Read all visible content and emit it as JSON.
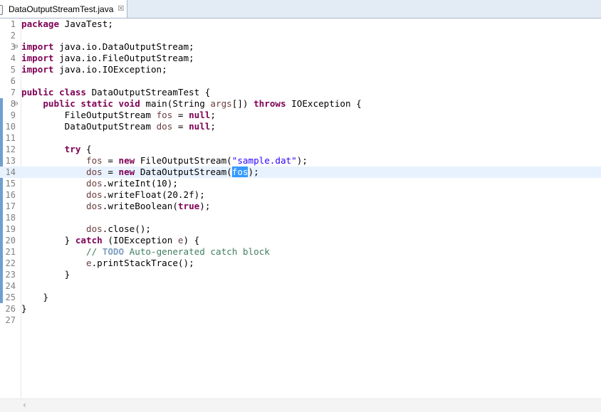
{
  "tab": {
    "title": "DataOutputStreamTest.java",
    "close_glyph": "☒"
  },
  "lines": [
    {
      "n": "1",
      "tokens": [
        {
          "t": "package",
          "c": "kw"
        },
        {
          "t": " JavaTest;",
          "c": ""
        }
      ]
    },
    {
      "n": "2",
      "tokens": []
    },
    {
      "n": "3",
      "fold": "⊖",
      "tokens": [
        {
          "t": "import",
          "c": "kw"
        },
        {
          "t": " java.io.DataOutputStream;",
          "c": ""
        }
      ]
    },
    {
      "n": "4",
      "tokens": [
        {
          "t": "import",
          "c": "kw"
        },
        {
          "t": " java.io.FileOutputStream;",
          "c": ""
        }
      ]
    },
    {
      "n": "5",
      "tokens": [
        {
          "t": "import",
          "c": "kw"
        },
        {
          "t": " java.io.IOException;",
          "c": ""
        }
      ]
    },
    {
      "n": "6",
      "tokens": []
    },
    {
      "n": "7",
      "tokens": [
        {
          "t": "public class",
          "c": "kw"
        },
        {
          "t": " DataOutputStreamTest {",
          "c": ""
        }
      ]
    },
    {
      "n": "8",
      "fold": "⊖",
      "changed": true,
      "tokens": [
        {
          "t": "    ",
          "c": ""
        },
        {
          "t": "public static void",
          "c": "kw"
        },
        {
          "t": " main(String ",
          "c": ""
        },
        {
          "t": "args",
          "c": "fld"
        },
        {
          "t": "[]) ",
          "c": ""
        },
        {
          "t": "throws",
          "c": "kw"
        },
        {
          "t": " IOException {",
          "c": ""
        }
      ]
    },
    {
      "n": "9",
      "changed": true,
      "tokens": [
        {
          "t": "        FileOutputStream ",
          "c": ""
        },
        {
          "t": "fos",
          "c": "fld"
        },
        {
          "t": " = ",
          "c": ""
        },
        {
          "t": "null",
          "c": "kw"
        },
        {
          "t": ";",
          "c": ""
        }
      ]
    },
    {
      "n": "10",
      "changed": true,
      "tokens": [
        {
          "t": "        DataOutputStream ",
          "c": ""
        },
        {
          "t": "dos",
          "c": "fld"
        },
        {
          "t": " = ",
          "c": ""
        },
        {
          "t": "null",
          "c": "kw"
        },
        {
          "t": ";",
          "c": ""
        }
      ]
    },
    {
      "n": "11",
      "changed": true,
      "tokens": []
    },
    {
      "n": "12",
      "changed": true,
      "tokens": [
        {
          "t": "        ",
          "c": ""
        },
        {
          "t": "try",
          "c": "kw"
        },
        {
          "t": " {",
          "c": ""
        }
      ]
    },
    {
      "n": "13",
      "changed": true,
      "tokens": [
        {
          "t": "            ",
          "c": ""
        },
        {
          "t": "fos",
          "c": "fld"
        },
        {
          "t": " = ",
          "c": ""
        },
        {
          "t": "new",
          "c": "kw"
        },
        {
          "t": " FileOutputStream(",
          "c": ""
        },
        {
          "t": "\"sample.dat\"",
          "c": "str"
        },
        {
          "t": ");",
          "c": ""
        }
      ]
    },
    {
      "n": "14",
      "changed": true,
      "current": true,
      "tokens": [
        {
          "t": "            ",
          "c": ""
        },
        {
          "t": "dos",
          "c": "fld"
        },
        {
          "t": " = ",
          "c": ""
        },
        {
          "t": "new",
          "c": "kw"
        },
        {
          "t": " DataOutputStream(",
          "c": ""
        },
        {
          "t": "fos",
          "c": "sel"
        },
        {
          "t": ");",
          "c": ""
        }
      ]
    },
    {
      "n": "15",
      "changed": true,
      "tokens": [
        {
          "t": "            ",
          "c": ""
        },
        {
          "t": "dos",
          "c": "fld"
        },
        {
          "t": ".writeInt(10);",
          "c": ""
        }
      ]
    },
    {
      "n": "16",
      "changed": true,
      "tokens": [
        {
          "t": "            ",
          "c": ""
        },
        {
          "t": "dos",
          "c": "fld"
        },
        {
          "t": ".writeFloat(20.2f);",
          "c": ""
        }
      ]
    },
    {
      "n": "17",
      "changed": true,
      "tokens": [
        {
          "t": "            ",
          "c": ""
        },
        {
          "t": "dos",
          "c": "fld"
        },
        {
          "t": ".writeBoolean(",
          "c": ""
        },
        {
          "t": "true",
          "c": "kw"
        },
        {
          "t": ");",
          "c": ""
        }
      ]
    },
    {
      "n": "18",
      "changed": true,
      "tokens": []
    },
    {
      "n": "19",
      "changed": true,
      "tokens": [
        {
          "t": "            ",
          "c": ""
        },
        {
          "t": "dos",
          "c": "fld"
        },
        {
          "t": ".close();",
          "c": ""
        }
      ]
    },
    {
      "n": "20",
      "changed": true,
      "tokens": [
        {
          "t": "        } ",
          "c": ""
        },
        {
          "t": "catch",
          "c": "kw"
        },
        {
          "t": " (IOException ",
          "c": ""
        },
        {
          "t": "e",
          "c": "fld"
        },
        {
          "t": ") {",
          "c": ""
        }
      ]
    },
    {
      "n": "21",
      "changed": true,
      "tokens": [
        {
          "t": "            ",
          "c": ""
        },
        {
          "t": "// ",
          "c": "cm"
        },
        {
          "t": "TODO",
          "c": "todo"
        },
        {
          "t": " Auto-generated catch block",
          "c": "cm"
        }
      ]
    },
    {
      "n": "22",
      "changed": true,
      "tokens": [
        {
          "t": "            ",
          "c": ""
        },
        {
          "t": "e",
          "c": "fld"
        },
        {
          "t": ".printStackTrace();",
          "c": ""
        }
      ]
    },
    {
      "n": "23",
      "changed": true,
      "tokens": [
        {
          "t": "        }",
          "c": ""
        }
      ]
    },
    {
      "n": "24",
      "changed": true,
      "tokens": []
    },
    {
      "n": "25",
      "changed": true,
      "tokens": [
        {
          "t": "    }",
          "c": ""
        }
      ]
    },
    {
      "n": "26",
      "tokens": [
        {
          "t": "}",
          "c": ""
        }
      ]
    },
    {
      "n": "27",
      "tokens": []
    }
  ],
  "scroll": {
    "left_arrow": "‹"
  },
  "colors": {
    "keyword": "#7f0055",
    "string": "#2a00ff",
    "field": "#6a3e3e",
    "comment": "#3f7f5f",
    "selection": "#3399ff",
    "current_line": "#e8f2fe"
  }
}
